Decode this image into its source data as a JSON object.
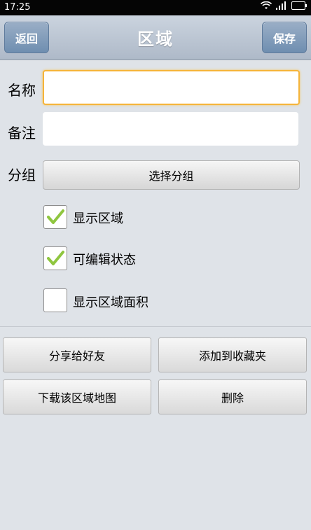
{
  "status": {
    "time": "17:25"
  },
  "header": {
    "title": "区域",
    "back_label": "返回",
    "save_label": "保存"
  },
  "form": {
    "name_label": "名称",
    "name_value": "",
    "note_label": "备注",
    "note_value": "",
    "group_label": "分组",
    "group_button": "选择分组"
  },
  "options": [
    {
      "label": "显示区域",
      "checked": true
    },
    {
      "label": "可编辑状态",
      "checked": true
    },
    {
      "label": "显示区域面积",
      "checked": false
    }
  ],
  "actions": {
    "share": "分享给好友",
    "favorite": "添加到收藏夹",
    "download": "下载该区域地图",
    "delete": "删除"
  },
  "colors": {
    "focus_border": "#f5b43a",
    "nav_button": "#7f99b8",
    "check_mark": "#8fc63f"
  }
}
